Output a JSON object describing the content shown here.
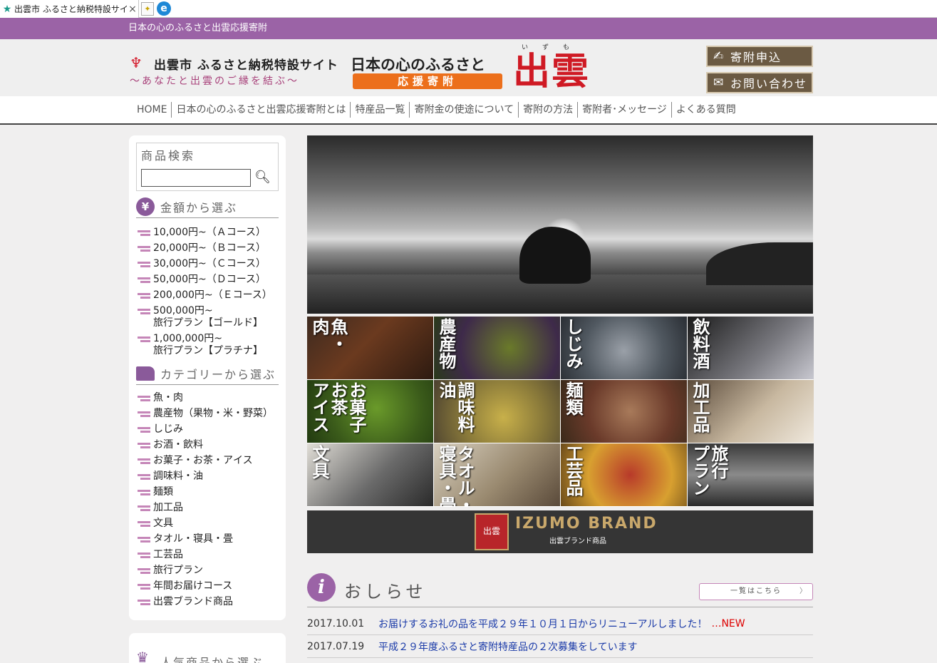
{
  "browser": {
    "tab_title": "出雲市 ふるさと納税特設サイト",
    "close": "×",
    "ie_glyph": "e",
    "new_tab_glyph": "✦"
  },
  "topbar": {
    "text": "日本の心のふるさと出雲応援寄附"
  },
  "header": {
    "logo_title": "出雲市 ふるさと納税特設サイト",
    "logo_sub": "～あなたと出雲のご縁を結ぶ～",
    "brand_line1": "日本の心のふるさと",
    "brand_orange": "応援寄附",
    "brand_izumo": "出雲",
    "brand_ruby": "いずも",
    "btn_kifu": "寄附申込",
    "btn_contact": "お問い合わせ"
  },
  "nav": {
    "items": [
      "HOME",
      "日本の心のふるさと出雲応援寄附とは",
      "特産品一覧",
      "寄附金の使途について",
      "寄附の方法",
      "寄附者･メッセージ",
      "よくある質問"
    ]
  },
  "sidebar": {
    "search_title": "商品検索",
    "search_value": "",
    "price_title": "金額から選ぶ",
    "price_icon": "¥",
    "price_items": [
      "10,000円~（Ａコース）",
      "20,000円~（Ｂコース）",
      "30,000円~（Ｃコース）",
      "50,000円~（Ｄコース）",
      "200,000円~（Ｅコース）",
      "500,000円~\n旅行プラン【ゴールド】",
      "1,000,000円~\n旅行プラン【プラチナ】"
    ],
    "category_title": "カテゴリーから選ぶ",
    "category_items": [
      "魚・肉",
      "農産物（果物・米・野菜）",
      "しじみ",
      "お酒・飲料",
      "お菓子・お茶・アイス",
      "調味料・油",
      "麺類",
      "加工品",
      "文具",
      "タオル・寝具・畳",
      "工芸品",
      "旅行プラン",
      "年間お届けコース",
      "出雲ブランド商品"
    ],
    "popular_title": "人気商品から選ぶ"
  },
  "categories": [
    "魚・\n肉",
    "農産物",
    "しじみ",
    "飲料酒",
    "お菓子\nお茶\nアイス",
    "調味料\n油",
    "麺類",
    "加工品",
    "文具",
    "タオル・\n寝具・畳",
    "工芸品",
    "旅行\nプラン"
  ],
  "banner": {
    "logo_text": "出雲",
    "brand": "IZUMO BRAND",
    "sub": "出雲ブランド商品"
  },
  "news": {
    "title": "おしらせ",
    "icon": "i",
    "more": "一覧はこちら",
    "items": [
      {
        "date": "2017.10.01",
        "text": "お届けするお礼の品を平成２９年１０月１日からリニューアルしました！",
        "new": "…NEW"
      },
      {
        "date": "2017.07.19",
        "text": "平成２９年度ふるさと寄附特産品の２次募集をしています",
        "new": ""
      }
    ]
  }
}
